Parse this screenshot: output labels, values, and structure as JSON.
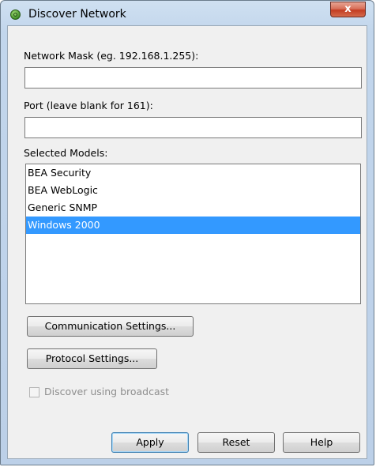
{
  "window": {
    "title": "Discover Network",
    "close_label": "x"
  },
  "form": {
    "network_mask_label": "Network Mask (eg. 192.168.1.255):",
    "network_mask_value": "",
    "port_label": "Port (leave blank for 161):",
    "port_value": "",
    "models_label": "Selected Models:",
    "models": [
      {
        "label": "BEA Security",
        "selected": false
      },
      {
        "label": "BEA WebLogic",
        "selected": false
      },
      {
        "label": "Generic SNMP",
        "selected": false
      },
      {
        "label": "Windows 2000",
        "selected": true
      }
    ],
    "communication_settings_label": "Communication Settings...",
    "protocol_settings_label": "Protocol Settings...",
    "broadcast_label": "Discover using broadcast",
    "broadcast_checked": false,
    "broadcast_enabled": false
  },
  "buttons": {
    "apply": "Apply",
    "reset": "Reset",
    "help": "Help"
  },
  "colors": {
    "selection": "#3399ff",
    "close_button": "#c33d22"
  }
}
